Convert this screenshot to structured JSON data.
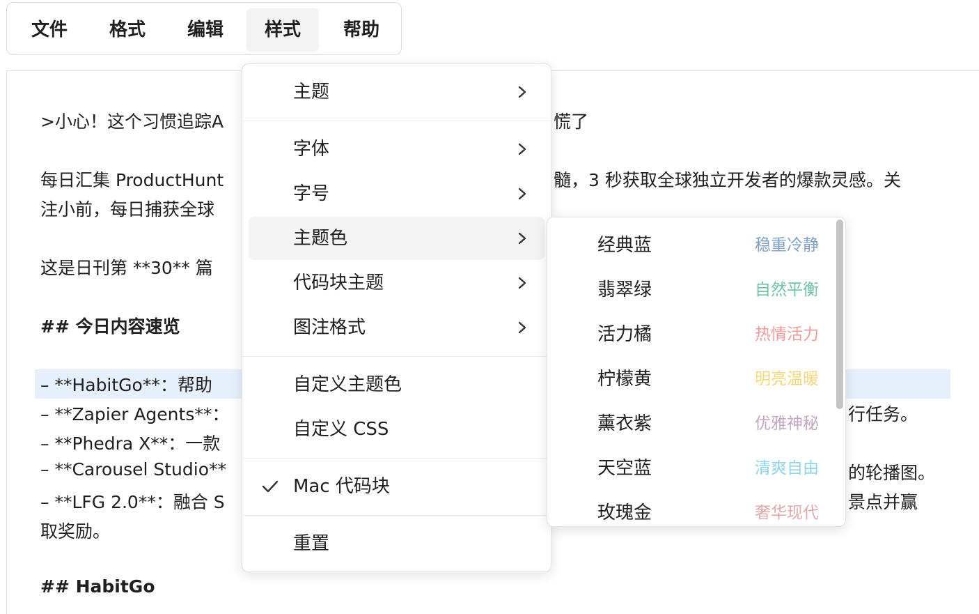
{
  "menubar": {
    "items": [
      {
        "label": "文件"
      },
      {
        "label": "格式"
      },
      {
        "label": "编辑"
      },
      {
        "label": "样式"
      },
      {
        "label": "帮助"
      }
    ]
  },
  "editor": {
    "lines": [
      ">小心！这个习惯追踪A",
      "慌了",
      "每日汇集 ProductHunt",
      "髓，3 秒获取全球独立开发者的爆款灵感。关",
      "注小前，每日捕获全球",
      "这是日刊第 **30** 篇",
      "## 今日内容速览",
      "– **HabitGo**：帮助",
      "– **Zapier Agents**：",
      "行任务。",
      "– **Phedra X**：一款",
      "– **Carousel Studio**",
      "的轮播图。",
      "– **LFG 2.0**：融合 S",
      "景点并赢",
      "取奖励。",
      "## HabitGo"
    ]
  },
  "dropdown": {
    "items": [
      {
        "label": "主题",
        "submenu": true
      },
      {
        "label": "字体",
        "submenu": true
      },
      {
        "label": "字号",
        "submenu": true
      },
      {
        "label": "主题色",
        "submenu": true
      },
      {
        "label": "代码块主题",
        "submenu": true
      },
      {
        "label": "图注格式",
        "submenu": true
      },
      {
        "label": "自定义主题色"
      },
      {
        "label": "自定义 CSS"
      },
      {
        "label": "Mac 代码块",
        "checked": true
      },
      {
        "label": "重置"
      }
    ],
    "chevron_icon": "chevron-right-icon",
    "check_icon": "checkmark-icon"
  },
  "theme_colors": {
    "items": [
      {
        "name": "经典蓝",
        "desc": "稳重冷静",
        "color": "#7f9fc6"
      },
      {
        "name": "翡翠绿",
        "desc": "自然平衡",
        "color": "#6fc3a1"
      },
      {
        "name": "活力橘",
        "desc": "热情活力",
        "color": "#f29b9b"
      },
      {
        "name": "柠檬黄",
        "desc": "明亮温暖",
        "color": "#f5d77a"
      },
      {
        "name": "薰衣紫",
        "desc": "优雅神秘",
        "color": "#c4a6c4"
      },
      {
        "name": "天空蓝",
        "desc": "清爽自由",
        "color": "#8ed6ea"
      },
      {
        "name": "玫瑰金",
        "desc": "奢华现代",
        "color": "#e0a9ab"
      }
    ]
  }
}
